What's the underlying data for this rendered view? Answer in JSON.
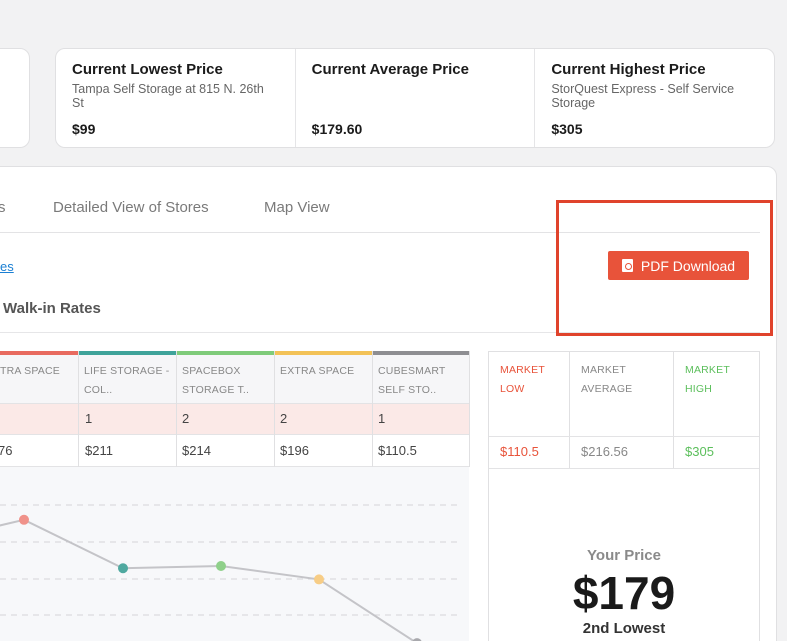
{
  "price_cards": [
    {
      "title": "Current Lowest Price",
      "subtitle": "Tampa Self Storage at 815 N. 26th St",
      "value": "$99"
    },
    {
      "title": "Current Average Price",
      "subtitle": "",
      "value": "$179.60"
    },
    {
      "title": "Current Highest Price",
      "subtitle": "StorQuest Express - Self Service Storage",
      "value": "$305"
    }
  ],
  "tabs": [
    {
      "label": "s"
    },
    {
      "label": "Detailed View of Stores"
    },
    {
      "label": "Map View"
    }
  ],
  "link_fragment": "es",
  "section_title": "Walk-in Rates",
  "pdf_button": {
    "label": "PDF Download",
    "icon": "pdf-file-icon"
  },
  "competitors": [
    {
      "name_line1": "TRA SPACE",
      "name_line2": "",
      "units": "",
      "price": "76",
      "color": "#e86a5f"
    },
    {
      "name_line1": "LIFE STORAGE -",
      "name_line2": "COL..",
      "units": "1",
      "price": "$211",
      "color": "#3fa39a"
    },
    {
      "name_line1": "SPACEBOX",
      "name_line2": "STORAGE T..",
      "units": "2",
      "price": "$214",
      "color": "#7fcb7a"
    },
    {
      "name_line1": "EXTRA SPACE",
      "name_line2": "",
      "units": "2",
      "price": "$196",
      "color": "#f3c257"
    },
    {
      "name_line1": "CUBESMART",
      "name_line2": "SELF STO..",
      "units": "1",
      "price": "$110.5",
      "color": "#8e8e92"
    }
  ],
  "market": {
    "low": {
      "label_line1": "MARKET",
      "label_line2": "LOW",
      "value": "$110.5",
      "color": "#e8533a"
    },
    "average": {
      "label_line1": "MARKET",
      "label_line2": "AVERAGE",
      "value": "$216.56",
      "color": "#888888"
    },
    "high": {
      "label_line1": "MARKET",
      "label_line2": "HIGH",
      "value": "$305",
      "color": "#5cbf5c"
    }
  },
  "your_price": {
    "label": "Your Price",
    "value": "$179",
    "rank": "2nd Lowest"
  },
  "chart_data": {
    "type": "line",
    "categories": [
      "TRA SPACE",
      "LIFE STORAGE - COL..",
      "SPACEBOX STORAGE T..",
      "EXTRA SPACE",
      "CUBESMART SELF STO.."
    ],
    "values": [
      276,
      211,
      214,
      196,
      110.5
    ],
    "point_colors": [
      "#f0928a",
      "#4fa9a0",
      "#8fd08a",
      "#f7cd86",
      "#a9a9ad"
    ],
    "ylim": [
      100,
      320
    ],
    "grid": true
  }
}
